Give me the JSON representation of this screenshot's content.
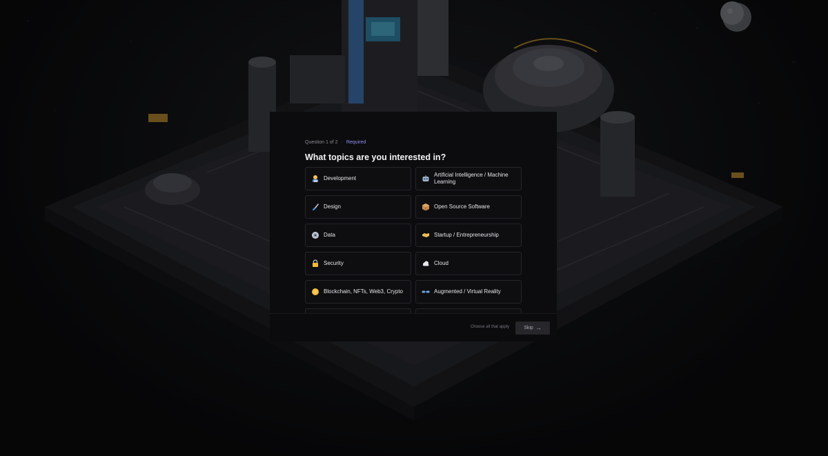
{
  "question": {
    "progress": "Question 1 of 2",
    "separator": "·",
    "required": "Required",
    "title": "What topics are you interested in?"
  },
  "options": [
    {
      "label": "Development",
      "icon": "technologist-icon",
      "selected": false
    },
    {
      "label": "Artificial Intelligence / Machine Learning",
      "icon": "robot-icon",
      "selected": false
    },
    {
      "label": "Design",
      "icon": "paintbrush-icon",
      "selected": false
    },
    {
      "label": "Open Source Software",
      "icon": "package-icon",
      "selected": false
    },
    {
      "label": "Data",
      "icon": "disk-icon",
      "selected": false
    },
    {
      "label": "Startup / Entrepreneurship",
      "icon": "handshake-icon",
      "selected": false
    },
    {
      "label": "Security",
      "icon": "lock-icon",
      "selected": false
    },
    {
      "label": "Cloud",
      "icon": "cloud-icon",
      "selected": false
    },
    {
      "label": "Blockchain, NFTs, Web3, Crypto",
      "icon": "coin-icon",
      "selected": false
    },
    {
      "label": "Augmented / Virtual Reality",
      "icon": "goggles-icon",
      "selected": false
    }
  ],
  "footer": {
    "hint": "Choose all that apply",
    "skip_label": "Skip",
    "skip_icon": "arrow-right-icon"
  },
  "colors": {
    "accent": "#8d8ef5",
    "modal_bg": "#0c0c0e",
    "option_border": "#25252b",
    "skip_bg": "#26262b"
  }
}
